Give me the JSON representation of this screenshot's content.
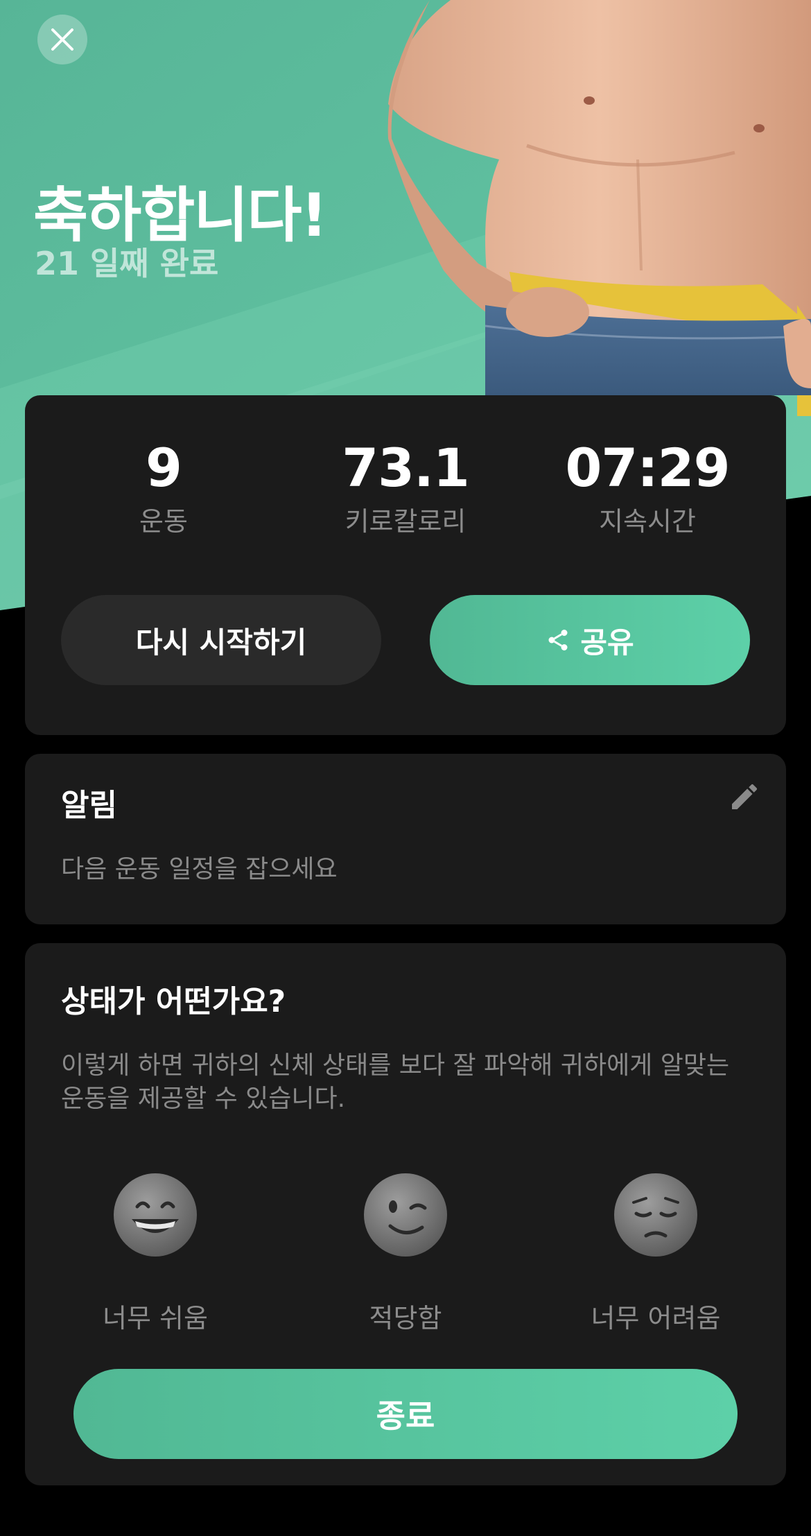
{
  "hero": {
    "title": "축하합니다!",
    "subtitle": "21 일째 완료",
    "close_icon": "close-icon",
    "image": "shirtless-man-measuring-waist-photo"
  },
  "stats": [
    {
      "value": "9",
      "label": "운동"
    },
    {
      "value": "73.1",
      "label": "키로칼로리"
    },
    {
      "value": "07:29",
      "label": "지속시간"
    }
  ],
  "actions": {
    "restart_label": "다시 시작하기",
    "share_label": "공유",
    "share_icon": "share-icon"
  },
  "notice": {
    "title": "알림",
    "text": "다음 운동 일정을 잡으세요",
    "edit_icon": "pencil-icon"
  },
  "feedback": {
    "title": "상태가 어떤가요?",
    "description_line1": "이렇게 하면 귀하의 신체 상태를 보다 잘 파악해 귀하에게 알맞는",
    "description_line2": "운동을 제공할 수 있습니다.",
    "options": [
      {
        "label": "너무 쉬움",
        "icon": "grinning-face-icon"
      },
      {
        "label": "적당함",
        "icon": "winking-face-icon"
      },
      {
        "label": "너무 어려움",
        "icon": "pensive-face-icon"
      }
    ]
  },
  "finish_label": "종료",
  "colors": {
    "accent": "#5BCBA4",
    "hero_background": "#5BB99A",
    "card_background": "#1B1B1B",
    "page_background": "#000000",
    "muted_text": "#8C8C8C"
  }
}
